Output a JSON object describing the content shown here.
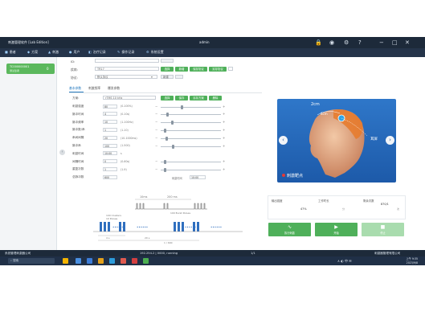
{
  "window": {
    "title": "刺激管理软件 [Lab Edition]",
    "user": "admin",
    "controls": [
      "−",
      "□",
      "✕"
    ],
    "top_icons": [
      "🔒",
      "◉",
      "⚙",
      "?"
    ]
  },
  "menu": [
    {
      "icon": "■",
      "label": "患者"
    },
    {
      "icon": "◆",
      "label": "方案"
    },
    {
      "icon": "▲",
      "label": "刺激"
    },
    {
      "icon": "●",
      "label": "用户"
    },
    {
      "icon": "◧",
      "label": "治疗记录"
    },
    {
      "icon": "✎",
      "label": "操作记录"
    },
    {
      "icon": "⚙",
      "label": "系统设置"
    }
  ],
  "patient": {
    "id": "TC000000001",
    "name": "测试患者",
    "count": "0"
  },
  "form": {
    "id_label": "ID:",
    "id_value": "",
    "disease_label": "疾病:",
    "disease_value": "TR17",
    "protocol_label": "协议:",
    "protocol_value": "默认协议",
    "buttons": [
      "选择",
      "新增",
      "保存协议",
      "另存协议"
    ],
    "tag": "新建"
  },
  "tabs": [
    "基本参数",
    "刺激频率",
    "爆发参数"
  ],
  "params_header": {
    "label": "方案:",
    "value": "rTMS 10 kHz",
    "buttons": [
      "选择",
      "保存",
      "另存方案",
      "删除"
    ]
  },
  "params": [
    {
      "label": "刺激强度",
      "value": "80",
      "unit": "(0-100%)",
      "knob": 0.35
    },
    {
      "label": "脉冲时间",
      "value": "4",
      "unit": "(0-10s)",
      "knob": 0.1
    },
    {
      "label": "脉冲频率",
      "value": "10",
      "unit": "(1-100Hz)",
      "knob": 0.18
    },
    {
      "label": "脉冲数/串",
      "value": "1",
      "unit": "(1-10)",
      "knob": 0.05
    },
    {
      "label": "串间间隔",
      "value": "20",
      "unit": "(10-1000ms)",
      "knob": 0.08
    },
    {
      "label": "脉冲串",
      "value": "100",
      "unit": "(1-500)",
      "knob": 0.2
    },
    {
      "label": "刺激时间",
      "value": "10:00",
      "unit": "s",
      "knob": null
    },
    {
      "label": "间隔时间",
      "value": "0",
      "unit": "(0-60s)",
      "knob": 0.05
    },
    {
      "label": "重复次数",
      "value": "1",
      "unit": "(1-9)",
      "knob": 0.05
    },
    {
      "label": "总脉冲数",
      "value": "600",
      "unit": "",
      "extra_label": "刺激时间",
      "extra_value": "10:00"
    }
  ],
  "diagram": {
    "label_top": "10ms",
    "label_top2": "200 ms",
    "label_interval": "100 Burst Pulses",
    "label_train": "100 Clusters",
    "label_train2": "10 Pulses",
    "label_bottom": "4 s",
    "label_bottom2": "20 s",
    "label_total": "1 / 600",
    "dots": "••••••"
  },
  "preview": {
    "d1": "2cm",
    "d2": "6cm",
    "ear": "耳屏",
    "target": "刺激靶点",
    "prev": "‹",
    "next": "›"
  },
  "stats": [
    {
      "label": "输出强度",
      "value": "",
      "unit": ""
    },
    {
      "label": "工作时长",
      "value": "47%",
      "unit": "分"
    },
    {
      "label": "剩余次数",
      "value": "870/1",
      "unit": "次"
    }
  ],
  "actions": [
    {
      "icon": "∿",
      "label": "执行刺激"
    },
    {
      "icon": "▶",
      "label": "开始"
    },
    {
      "icon": "■",
      "label": "停止"
    }
  ],
  "statusbar": {
    "left": "系统管理刺激器公司",
    "middle": "192.254.2 | 0000, running",
    "page": "1/1",
    "right": "刺激器管理有限公司"
  },
  "taskbar": {
    "search": "搜索",
    "time": "上午 9:35",
    "date": "2023/9/8",
    "tray": "∧ ◐ 中 ✉"
  }
}
